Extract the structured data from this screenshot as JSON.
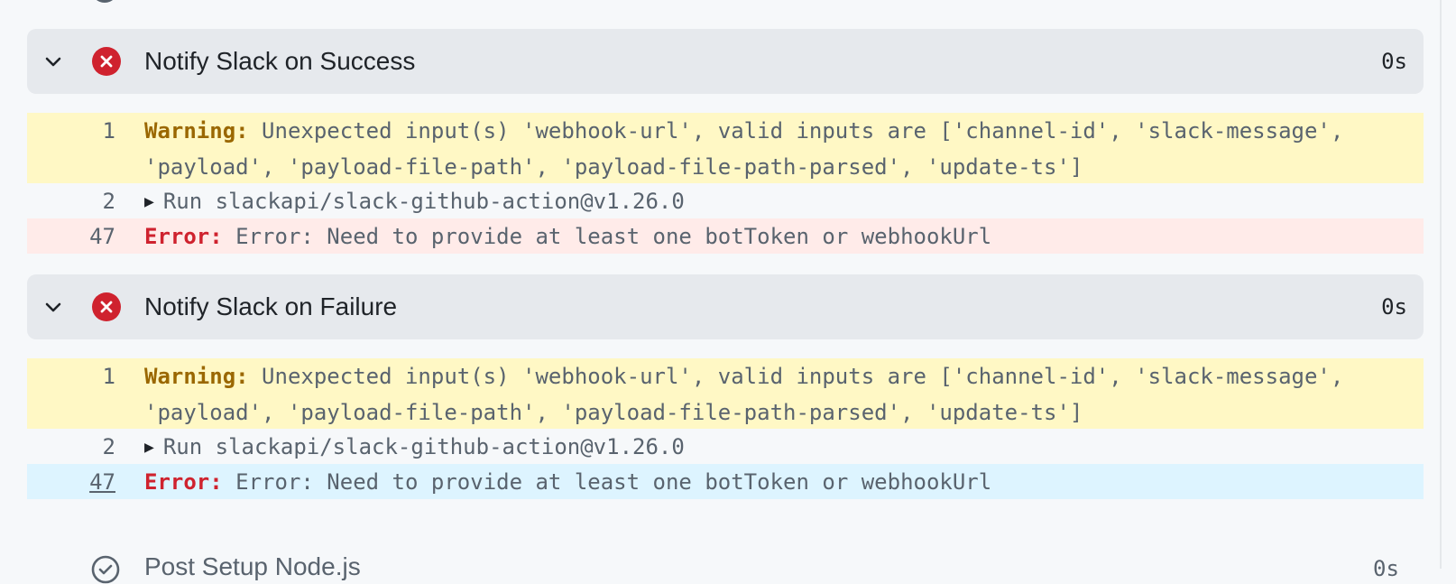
{
  "colors": {
    "error_icon": "#cf222e",
    "warning_bg": "#fff8c5",
    "error_bg": "#ffebe9",
    "selected_bg": "#ddf4ff",
    "header_bg": "#e6e9ed"
  },
  "steps": [
    {
      "title": "Notify Slack on Success",
      "duration": "0s",
      "status_icon": "x-circle-icon",
      "lines": [
        {
          "num": "1",
          "label": "Warning:",
          "text": " Unexpected input(s) 'webhook-url', valid inputs are ['channel-id', 'slack-message', 'payload', 'payload-file-path', 'payload-file-path-parsed', 'update-ts']"
        },
        {
          "num": "2",
          "text": "Run slackapi/slack-github-action@v1.26.0"
        },
        {
          "num": "47",
          "label": "Error:",
          "text": " Error: Need to provide at least one botToken or webhookUrl"
        }
      ]
    },
    {
      "title": "Notify Slack on Failure",
      "duration": "0s",
      "status_icon": "x-circle-icon",
      "lines": [
        {
          "num": "1",
          "label": "Warning:",
          "text": " Unexpected input(s) 'webhook-url', valid inputs are ['channel-id', 'slack-message', 'payload', 'payload-file-path', 'payload-file-path-parsed', 'update-ts']"
        },
        {
          "num": "2",
          "text": "Run slackapi/slack-github-action@v1.26.0"
        },
        {
          "num": "47",
          "label": "Error:",
          "text": " Error: Need to provide at least one botToken or webhookUrl"
        }
      ]
    }
  ],
  "next_step": {
    "title": "Post Setup Node.js",
    "duration": "0s",
    "status_icon": "check-circle-icon"
  }
}
